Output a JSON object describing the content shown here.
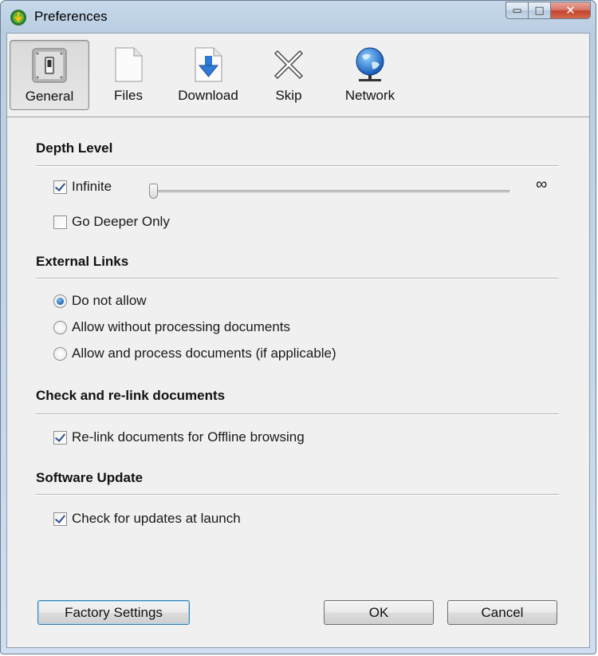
{
  "window": {
    "title": "Preferences"
  },
  "caption": {
    "minimize": "▭",
    "maximize": "□",
    "close": "✕"
  },
  "toolbar": {
    "items": [
      {
        "label": "General",
        "icon": "general-switch-icon",
        "selected": true
      },
      {
        "label": "Files",
        "icon": "file-icon",
        "selected": false
      },
      {
        "label": "Download",
        "icon": "download-icon",
        "selected": false
      },
      {
        "label": "Skip",
        "icon": "skip-x-icon",
        "selected": false
      },
      {
        "label": "Network",
        "icon": "globe-network-icon",
        "selected": false
      }
    ]
  },
  "depth": {
    "title": "Depth Level",
    "infinite_label": "Infinite",
    "infinite_checked": true,
    "slider_value": "∞",
    "slider_level": 0,
    "deeper_label": "Go Deeper Only",
    "deeper_checked": false
  },
  "external": {
    "title": "External Links",
    "options": [
      {
        "label": "Do not allow",
        "checked": true
      },
      {
        "label": "Allow without processing documents",
        "checked": false
      },
      {
        "label": "Allow and process documents (if applicable)",
        "checked": false
      }
    ]
  },
  "relink": {
    "title": "Check and re-link documents",
    "label": "Re-link documents for Offline browsing",
    "checked": true
  },
  "update": {
    "title": "Software Update",
    "label": "Check for updates at launch",
    "checked": true
  },
  "buttons": {
    "factory": "Factory Settings",
    "ok": "OK",
    "cancel": "Cancel"
  },
  "colors": {
    "accent": "#1f64b0",
    "client_bg": "#f0f0f0",
    "frame": "#b9cde2",
    "close": "#c4432e"
  }
}
